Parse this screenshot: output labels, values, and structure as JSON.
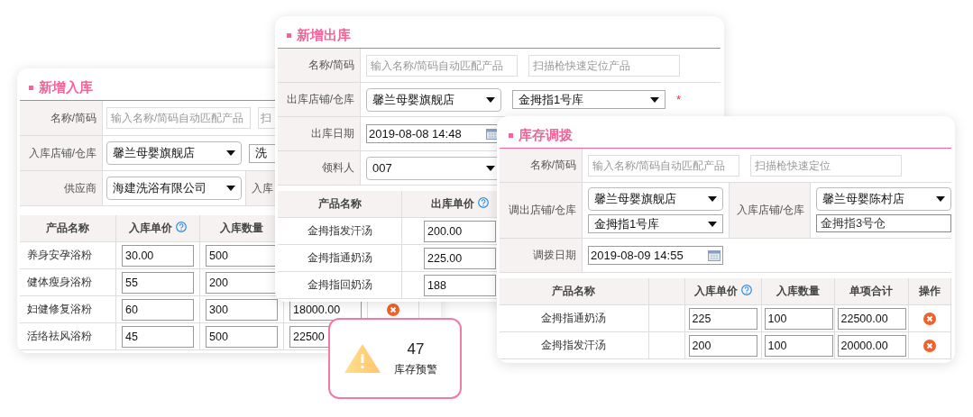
{
  "stock_in": {
    "title": "新增入库",
    "form": [
      {
        "cells": [
          {
            "kind": "label",
            "text": "名称/简码"
          },
          {
            "kind": "fields",
            "fields": [
              {
                "kind": "input",
                "placeholder": "输入名称/简码自动匹配产品"
              },
              {
                "kind": "input",
                "placeholder": "扫"
              }
            ]
          }
        ]
      },
      {
        "cells": [
          {
            "kind": "label",
            "text": "入库店铺/仓库"
          },
          {
            "kind": "fields",
            "fields": [
              {
                "kind": "select",
                "value": "馨兰母婴旗舰店"
              },
              {
                "kind": "partial",
                "value": "洗"
              }
            ]
          }
        ]
      },
      {
        "cells": [
          {
            "kind": "label",
            "text": "供应商"
          },
          {
            "kind": "fields",
            "fields": [
              {
                "kind": "select",
                "value": "海建洗浴有限公司"
              }
            ]
          },
          {
            "kind": "label",
            "text": "入库"
          }
        ]
      }
    ],
    "table": {
      "columns": [
        {
          "label": "产品名称",
          "help": false
        },
        {
          "label": "入库单价",
          "help": true
        },
        {
          "label": "入库数量",
          "help": false
        }
      ],
      "rows": [
        {
          "kind": "plain",
          "name": "养身安孕浴粉",
          "price": "30.00",
          "quantity": "500"
        },
        {
          "kind": "plain",
          "name": "健体瘦身浴粉",
          "price": "55",
          "quantity": "200"
        },
        {
          "kind": "deletable",
          "name": "妇健修复浴粉",
          "price": "60",
          "quantity": "300",
          "total": "18000.00"
        },
        {
          "kind": "plain",
          "name": "活络祛风浴粉",
          "price": "45",
          "quantity": "500",
          "total": "22500"
        }
      ]
    }
  },
  "stock_out": {
    "title": "新增出库",
    "form": [
      {
        "cells": [
          {
            "kind": "label",
            "text": "名称/简码"
          },
          {
            "kind": "fields",
            "fields": [
              {
                "kind": "input",
                "placeholder": "输入名称/简码自动匹配产品"
              },
              {
                "kind": "input",
                "placeholder": "扫描枪快速定位产品"
              }
            ]
          }
        ]
      },
      {
        "cells": [
          {
            "kind": "label",
            "text": "出库店铺/仓库"
          },
          {
            "kind": "fields",
            "fields": [
              {
                "kind": "select",
                "value": "馨兰母婴旗舰店"
              },
              {
                "kind": "dropdown",
                "value": "金拇指1号库"
              },
              {
                "kind": "required",
                "text": "*"
              }
            ]
          }
        ]
      },
      {
        "cells": [
          {
            "kind": "label",
            "text": "出库日期"
          },
          {
            "kind": "fields",
            "fields": [
              {
                "kind": "date",
                "value": "2019-08-08 14:48"
              }
            ]
          }
        ]
      },
      {
        "cells": [
          {
            "kind": "label",
            "text": "领料人"
          },
          {
            "kind": "fields",
            "fields": [
              {
                "kind": "select",
                "value": "007"
              }
            ]
          }
        ]
      }
    ],
    "table": {
      "columns": [
        {
          "label": "产品名称",
          "help": false
        },
        {
          "label": "出库单价",
          "help": true
        }
      ],
      "rows": [
        {
          "name": "金拇指发汗汤",
          "price": "200.00"
        },
        {
          "name": "金拇指通奶汤",
          "price": "225.00"
        },
        {
          "name": "金拇指回奶汤",
          "price": "188"
        }
      ]
    }
  },
  "transfer": {
    "title": "库存调拨",
    "form": [
      {
        "cells": [
          {
            "kind": "label",
            "text": "名称/简码"
          },
          {
            "kind": "fields",
            "fields": [
              {
                "kind": "input",
                "placeholder": "输入名称/简码自动匹配产品"
              },
              {
                "kind": "input",
                "placeholder": "扫描枪快速定位"
              }
            ]
          }
        ]
      },
      {
        "cells": [
          {
            "kind": "label",
            "text": "调出店铺/仓库"
          },
          {
            "kind": "stack",
            "fields": [
              {
                "kind": "select",
                "value": "馨兰母婴旗舰店"
              },
              {
                "kind": "dropdown",
                "value": "金拇指1号库"
              }
            ]
          },
          {
            "kind": "label",
            "text": "入库店铺/仓库"
          },
          {
            "kind": "stack",
            "fields": [
              {
                "kind": "select",
                "value": "馨兰母婴陈村店"
              },
              {
                "kind": "input",
                "value": "金拇指3号仓"
              }
            ]
          }
        ]
      },
      {
        "cells": [
          {
            "kind": "label",
            "text": "调拨日期"
          },
          {
            "kind": "fields",
            "fields": [
              {
                "kind": "date",
                "value": "2019-08-09 14:55"
              }
            ]
          }
        ]
      }
    ],
    "table": {
      "columns": [
        {
          "label": "产品名称",
          "help": false
        },
        {
          "label": "入库单价",
          "help": true
        },
        {
          "label": "入库数量",
          "help": false
        },
        {
          "label": "单项合计",
          "help": false
        },
        {
          "label": "操作",
          "help": false
        }
      ],
      "rows": [
        {
          "name": "金拇指通奶汤",
          "price": "225",
          "quantity": "100",
          "total": "22500.00"
        },
        {
          "name": "金拇指发汗汤",
          "price": "200",
          "quantity": "100",
          "total": "20000.00"
        }
      ]
    }
  },
  "alert": {
    "count": "47",
    "label": "库存预警"
  }
}
